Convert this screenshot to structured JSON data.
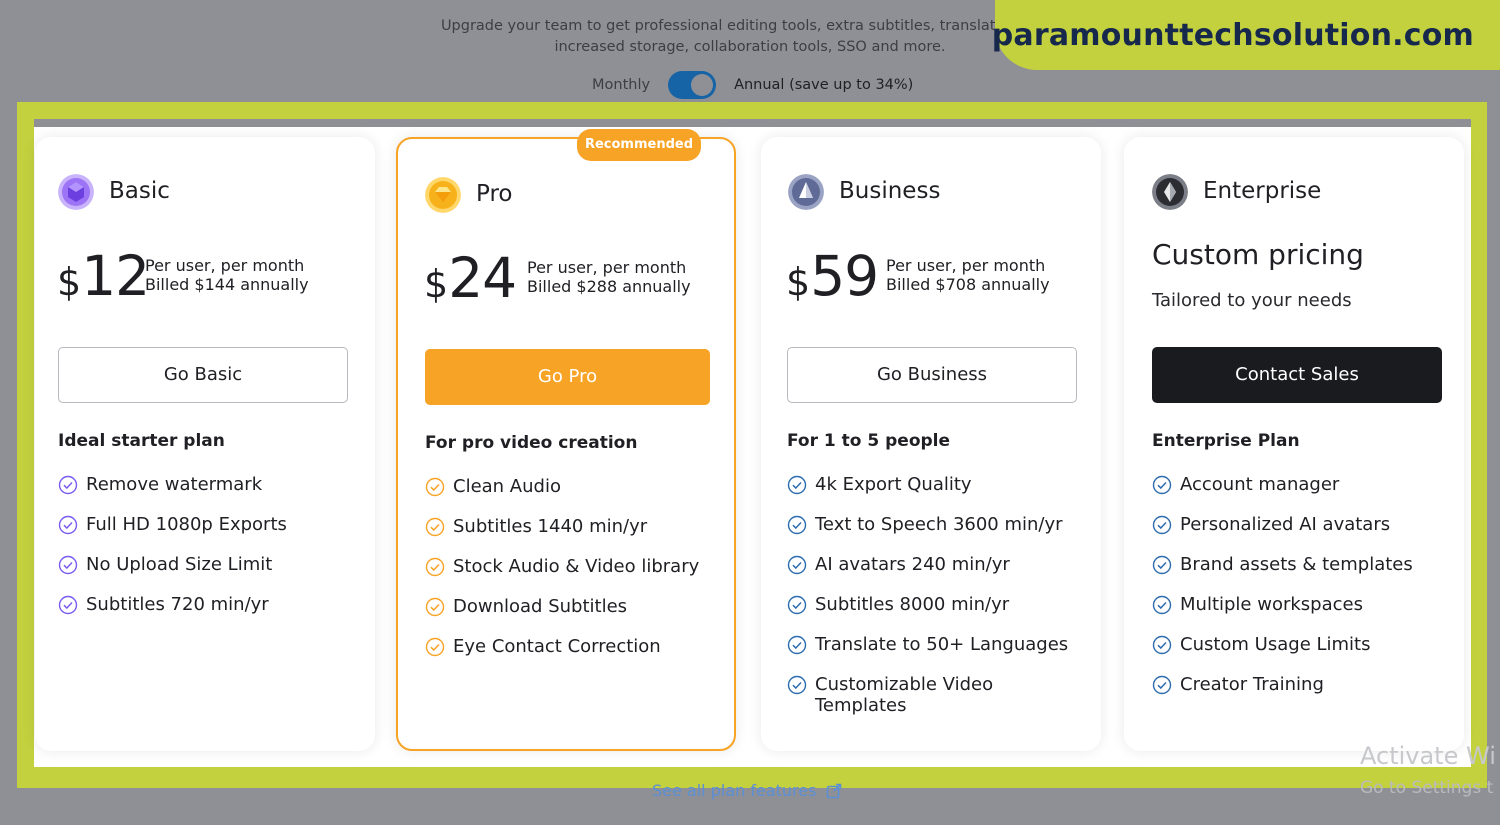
{
  "header": {
    "description_line1": "Upgrade your team to get professional editing tools, extra subtitles, translations, cus",
    "description_line2": "increased storage, collaboration tools, SSO and more.",
    "billing_monthly": "Monthly",
    "billing_annual": "Annual (save up to 34%)",
    "billing_annual_selected": true
  },
  "banner": {
    "text": "paramounttechsolution.com"
  },
  "plans": [
    {
      "name": "Basic",
      "currency": "$",
      "price": "12",
      "note_line1": "Per user, per month",
      "note_line2": "Billed $144 annually",
      "button": "Go Basic",
      "subtitle": "Ideal starter plan",
      "features": [
        "Remove watermark",
        "Full HD 1080p Exports",
        "No Upload Size Limit",
        "Subtitles 720 min/yr"
      ],
      "icon": "purple-gem-icon",
      "accent": "#7b5cf0"
    },
    {
      "name": "Pro",
      "badge": "Recommended",
      "currency": "$",
      "price": "24",
      "note_line1": "Per user, per month",
      "note_line2": "Billed $288 annually",
      "button": "Go Pro",
      "subtitle": "For pro video creation",
      "features": [
        "Clean Audio",
        "Subtitles 1440 min/yr",
        "Stock Audio & Video library",
        "Download Subtitles",
        "Eye Contact Correction"
      ],
      "icon": "gold-diamond-icon",
      "accent": "#f7a325"
    },
    {
      "name": "Business",
      "currency": "$",
      "price": "59",
      "note_line1": "Per user, per month",
      "note_line2": "Billed $708 annually",
      "button": "Go Business",
      "subtitle": "For 1 to 5 people",
      "features": [
        "4k Export Quality",
        "Text to Speech 3600 min/yr",
        "AI avatars 240 min/yr",
        "Subtitles 8000 min/yr",
        "Translate to 50+ Languages",
        "Customizable Video",
        "Templates"
      ],
      "icon": "sailboat-icon",
      "accent": "#2d6cae"
    },
    {
      "name": "Enterprise",
      "custom_pricing": "Custom pricing",
      "tailored": "Tailored to your needs",
      "button": "Contact Sales",
      "subtitle": "Enterprise Plan",
      "features": [
        "Account manager",
        "Personalized AI avatars",
        "Brand assets & templates",
        "Multiple workspaces",
        "Custom Usage Limits",
        "Creator Training"
      ],
      "icon": "dark-diamond-icon",
      "accent": "#2d6cae"
    }
  ],
  "footer": {
    "see_all": "See all plan features",
    "watermark_line1": "Activate Wi",
    "watermark_line2": "Go to Settings t"
  }
}
